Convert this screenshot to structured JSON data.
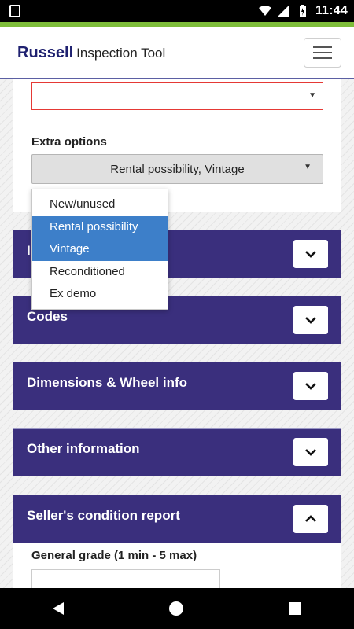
{
  "status_bar": {
    "time": "11:44"
  },
  "header": {
    "brand_strong": "Russell",
    "brand_rest": "Inspection Tool",
    "menu_icon": "hamburger-icon"
  },
  "form": {
    "extra_options_label": "Extra options",
    "extra_options_value": "Rental possibility, Vintage",
    "extra_options_list": [
      {
        "label": "New/unused",
        "selected": false
      },
      {
        "label": "Rental possibility",
        "selected": true
      },
      {
        "label": "Vintage",
        "selected": true
      },
      {
        "label": "Reconditioned",
        "selected": false
      },
      {
        "label": "Ex demo",
        "selected": false
      }
    ]
  },
  "sections": [
    {
      "title": "I",
      "state": "collapsed",
      "toggle_icon": "chevron-down-icon"
    },
    {
      "title": "Codes",
      "state": "collapsed",
      "toggle_icon": "chevron-down-icon"
    },
    {
      "title": "Dimensions & Wheel info",
      "state": "collapsed",
      "toggle_icon": "chevron-down-icon"
    },
    {
      "title": "Other information",
      "state": "collapsed",
      "toggle_icon": "chevron-down-icon"
    },
    {
      "title": "Seller's condition report",
      "state": "expanded",
      "toggle_icon": "chevron-up-icon"
    }
  ],
  "condition_report": {
    "general_grade_label": "General grade (1 min - 5 max)"
  },
  "colors": {
    "brand": "#1f2170",
    "section_bg": "#3a2f7d",
    "accent_green": "#7ebd3a",
    "selected_option": "#3d7fc9",
    "error_border": "#e53935"
  }
}
